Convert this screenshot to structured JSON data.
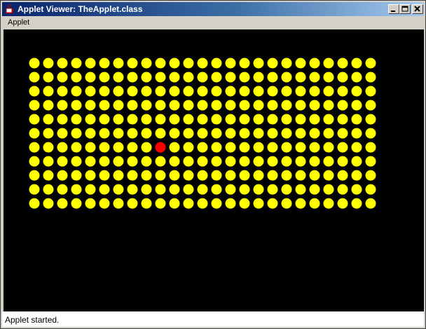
{
  "window": {
    "title": "Applet Viewer: TheApplet.class"
  },
  "menu": {
    "items": [
      "Applet"
    ]
  },
  "status": {
    "text": "Applet started."
  },
  "grid": {
    "columns": 25,
    "rows": 11,
    "highlighted": {
      "row": 6,
      "column": 9
    },
    "colors": {
      "background": "#000000",
      "dot": "#ffff00",
      "highlight": "#ff0000"
    }
  },
  "icons": {
    "app": "java-cup-icon",
    "minimize": "minimize-icon",
    "maximize": "maximize-icon",
    "close": "close-icon"
  }
}
